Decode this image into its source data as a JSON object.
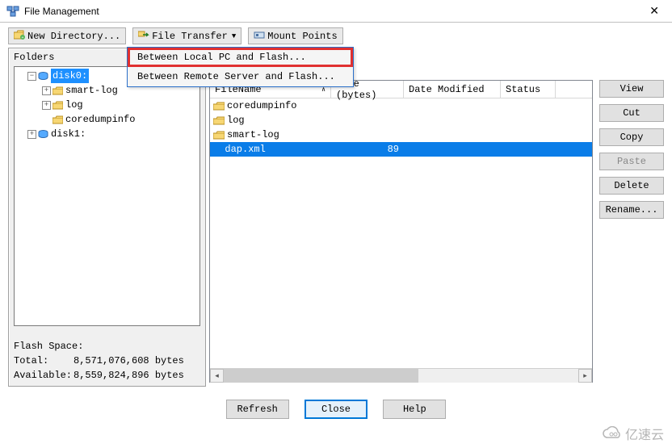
{
  "window": {
    "title": "File Management",
    "close": "✕"
  },
  "toolbar": {
    "new_dir": "New Directory...",
    "file_transfer": "File Transfer",
    "mount_points": "Mount Points"
  },
  "dropdown": {
    "item1": "Between Local PC and Flash...",
    "item2": "Between Remote Server and Flash..."
  },
  "folders": {
    "label": "Folders",
    "disk0": "disk0:",
    "smart_log": "smart-log",
    "log": "log",
    "coredump": "coredumpinfo",
    "disk1": "disk1:"
  },
  "flash": {
    "heading": "Flash Space:",
    "total_label": "Total:",
    "total_value": "8,571,076,608 bytes",
    "avail_label": "Available:",
    "avail_value": "8,559,824,896 bytes"
  },
  "columns": {
    "name": "FileName",
    "size": "Size (bytes)",
    "date": "Date Modified",
    "status": "Status"
  },
  "files": [
    {
      "name": "coredumpinfo",
      "type": "folder",
      "size": "",
      "selected": false
    },
    {
      "name": "log",
      "type": "folder",
      "size": "",
      "selected": false
    },
    {
      "name": "smart-log",
      "type": "folder",
      "size": "",
      "selected": false
    },
    {
      "name": "dap.xml",
      "type": "file",
      "size": "89",
      "selected": true
    }
  ],
  "actions": {
    "view": "View",
    "cut": "Cut",
    "copy": "Copy",
    "paste": "Paste",
    "delete": "Delete",
    "rename": "Rename..."
  },
  "bottom": {
    "refresh": "Refresh",
    "close": "Close",
    "help": "Help"
  },
  "watermark": "亿速云"
}
